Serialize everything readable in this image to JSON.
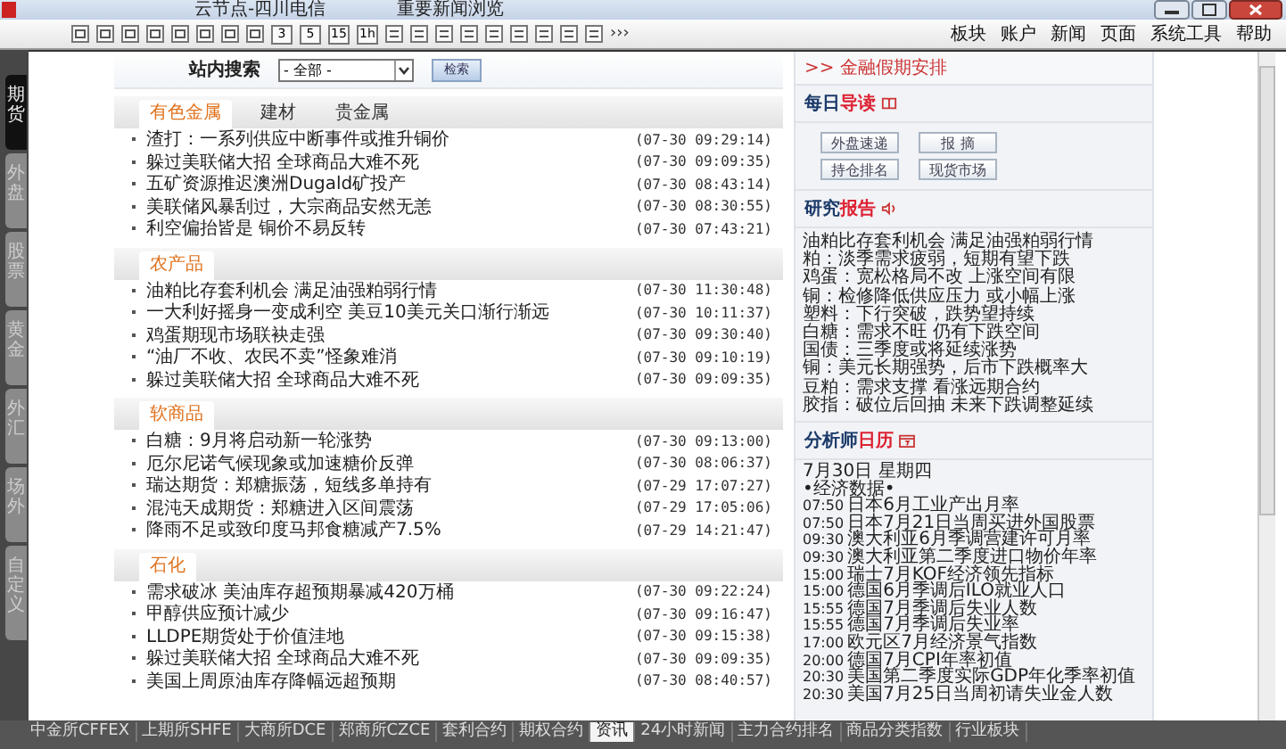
{
  "title_bar": {
    "items": [
      "云节点-四川电信",
      "重要新闻浏览"
    ]
  },
  "toolbar": {
    "buttons": [
      "3",
      "5",
      "15",
      "1h"
    ],
    "more": "›››"
  },
  "menu": [
    "板块",
    "账户",
    "新闻",
    "页面",
    "系统工具",
    "帮助"
  ],
  "side_tabs": [
    {
      "label": "期货",
      "selected": true
    },
    {
      "label": "外盘",
      "selected": false
    },
    {
      "label": "股票",
      "selected": false
    },
    {
      "label": "黄金",
      "selected": false
    },
    {
      "label": "外汇",
      "selected": false
    },
    {
      "label": "场外",
      "selected": false
    },
    {
      "label": "自定义",
      "selected": false
    }
  ],
  "search": {
    "label": "站内搜索",
    "value": "- 全部 -",
    "button": "检索"
  },
  "sections": [
    {
      "tabs": [
        {
          "label": "有色金属",
          "selected": true
        },
        {
          "label": "建材",
          "selected": false
        },
        {
          "label": "贵金属",
          "selected": false
        }
      ],
      "items": [
        {
          "title": "渣打：一系列供应中断事件或推升铜价",
          "time": "(07-30 09:29:14)"
        },
        {
          "title": "躲过美联储大招 全球商品大难不死",
          "time": "(07-30 09:09:35)"
        },
        {
          "title": "五矿资源推迟澳洲Dugald矿投产",
          "time": "(07-30 08:43:14)"
        },
        {
          "title": "美联储风暴刮过，大宗商品安然无恙",
          "time": "(07-30 08:30:55)"
        },
        {
          "title": "利空偏抬皆是 铜价不易反转",
          "time": "(07-30 07:43:21)"
        }
      ]
    },
    {
      "tabs": [
        {
          "label": "农产品",
          "selected": true
        }
      ],
      "items": [
        {
          "title": "油粕比存套利机会 满足油强粕弱行情",
          "time": "(07-30 11:30:48)"
        },
        {
          "title": "一大利好摇身一变成利空 美豆10美元关口渐行渐远",
          "time": "(07-30 10:11:37)"
        },
        {
          "title": "鸡蛋期现市场联袂走强",
          "time": "(07-30 09:30:40)"
        },
        {
          "title": "“油厂不收、农民不卖”怪象难消",
          "time": "(07-30 09:10:19)"
        },
        {
          "title": "躲过美联储大招 全球商品大难不死",
          "time": "(07-30 09:09:35)"
        }
      ]
    },
    {
      "tabs": [
        {
          "label": "软商品",
          "selected": true
        }
      ],
      "items": [
        {
          "title": "白糖：9月将启动新一轮涨势",
          "time": "(07-30 09:13:00)"
        },
        {
          "title": "厄尔尼诺气候现象或加速糖价反弹",
          "time": "(07-30 08:06:37)"
        },
        {
          "title": "瑞达期货：郑糖振荡，短线多单持有",
          "time": "(07-29 17:07:27)"
        },
        {
          "title": "混沌天成期货：郑糖进入区间震荡",
          "time": "(07-29 17:05:06)"
        },
        {
          "title": "降雨不足或致印度马邦食糖减产7.5%",
          "time": "(07-29 14:21:47)"
        }
      ]
    },
    {
      "tabs": [
        {
          "label": "石化",
          "selected": true
        }
      ],
      "items": [
        {
          "title": "需求破冰 美油库存超预期暴减420万桶",
          "time": "(07-30 09:22:24)"
        },
        {
          "title": "甲醇供应预计减少",
          "time": "(07-30 09:16:47)"
        },
        {
          "title": "LLDPE期货处于价值洼地",
          "time": "(07-30 09:15:38)"
        },
        {
          "title": "躲过美联储大招 全球商品大难不死",
          "time": "(07-30 09:09:35)"
        },
        {
          "title": "美国上周原油库存降幅远超预期",
          "time": "(07-30 08:40:57)"
        }
      ]
    }
  ],
  "right_panel": {
    "link": ">> 金融假期安排",
    "daily": {
      "title_main": "每日",
      "title_accent": "导读",
      "buttons": [
        "外盘速递",
        "报 摘",
        "持仓排名",
        "现货市场"
      ]
    },
    "research": {
      "title_main": "研究",
      "title_accent": "报告",
      "lines": [
        "油粕比存套利机会 满足油强粕弱行情",
        "粕：淡季需求疲弱，短期有望下跌",
        "鸡蛋：宽松格局不改 上涨空间有限",
        "铜：检修降低供应压力 或小幅上涨",
        "塑料：下行突破，跌势望持续",
        "白糖：需求不旺 仍有下跌空间",
        "国债：三季度或将延续涨势",
        "铜：美元长期强势，后市下跌概率大",
        "豆粕：需求支撑 看涨远期合约",
        "胶指：破位后回抽 未来下跌调整延续"
      ]
    },
    "calendar": {
      "title_main": "分析师",
      "title_accent": "日历",
      "date": "7月30日 星期四",
      "group": "•经济数据•",
      "events": [
        {
          "time": "07:50",
          "text": "日本6月工业产出月率"
        },
        {
          "time": "07:50",
          "text": "日本7月21日当周买进外国股票"
        },
        {
          "time": "09:30",
          "text": "澳大利亚6月季调营建许可月率"
        },
        {
          "time": "09:30",
          "text": "澳大利亚第二季度进口物价年率"
        },
        {
          "time": "15:00",
          "text": "瑞士7月KOF经济领先指标"
        },
        {
          "time": "15:00",
          "text": "德国6月季调后ILO就业人口"
        },
        {
          "time": "15:55",
          "text": "德国7月季调后失业人数"
        },
        {
          "time": "15:55",
          "text": "德国7月季调后失业率"
        },
        {
          "time": "17:00",
          "text": "欧元区7月经济景气指数"
        },
        {
          "time": "20:00",
          "text": "德国7月CPI年率初值"
        },
        {
          "time": "20:30",
          "text": "美国第二季度实际GDP年化季率初值"
        },
        {
          "time": "20:30",
          "text": "美国7月25日当周初请失业金人数"
        }
      ]
    }
  },
  "status_bar": [
    {
      "label": "中金所CFFEX",
      "selected": false
    },
    {
      "label": "上期所SHFE",
      "selected": false
    },
    {
      "label": "大商所DCE",
      "selected": false
    },
    {
      "label": "郑商所CZCE",
      "selected": false
    },
    {
      "label": "套利合约",
      "selected": false
    },
    {
      "label": "期权合约",
      "selected": false
    },
    {
      "label": "资讯",
      "selected": true
    },
    {
      "label": "24小时新闻",
      "selected": false
    },
    {
      "label": "主力合约排名",
      "selected": false
    },
    {
      "label": "商品分类指数",
      "selected": false
    },
    {
      "label": "行业板块",
      "selected": false
    }
  ]
}
